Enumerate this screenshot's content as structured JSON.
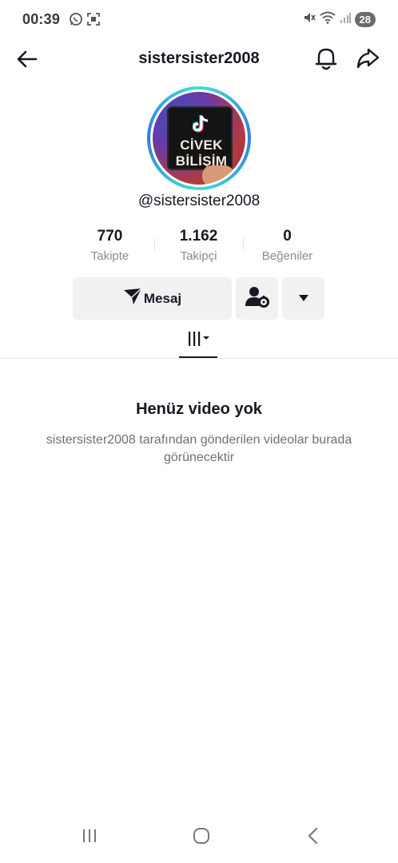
{
  "status_bar": {
    "time": "00:39",
    "battery": "28",
    "left_icons": [
      "whatsapp-icon",
      "screenshot-icon"
    ],
    "right_icons": [
      "mute-icon",
      "wifi-icon",
      "signal-icon",
      "battery-icon"
    ]
  },
  "header": {
    "title": "sistersister2008",
    "icons": [
      "back-arrow-icon",
      "bell-icon",
      "share-icon"
    ]
  },
  "profile": {
    "avatar_text_line1": "CİVEK",
    "avatar_text_line2": "BİLİŞİM",
    "username": "@sistersister2008"
  },
  "stats": [
    {
      "value": "770",
      "label": "Takipte"
    },
    {
      "value": "1.162",
      "label": "Takipçi"
    },
    {
      "value": "0",
      "label": "Beğeniler"
    }
  ],
  "actions": {
    "message_label": "Mesaj",
    "icons": [
      "send-icon",
      "user-settings-icon",
      "caret-down-icon"
    ]
  },
  "tabs": {
    "active_icon": "videos-grid-icon"
  },
  "empty_state": {
    "title": "Henüz video yok",
    "description": "sistersister2008 tarafından gönderilen videolar burada görünecektir"
  },
  "nav_bar": {
    "icons": [
      "recents-icon",
      "home-icon",
      "nav-back-icon"
    ]
  },
  "colors": {
    "ring_start": "#3fe0d8",
    "ring_end": "#2f7de0",
    "button_bg": "#f1f1f2",
    "text": "#161823",
    "muted": "#8a8b91"
  }
}
